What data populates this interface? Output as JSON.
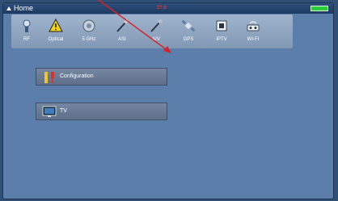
{
  "header": {
    "title": "Home",
    "center_text": "27.8",
    "icons": {
      "home": "home-icon",
      "battery": "battery-icon"
    }
  },
  "modules": [
    {
      "id": "rf",
      "label": "RF",
      "icon": "antenna-icon"
    },
    {
      "id": "optical",
      "label": "Optical",
      "icon": "warning-triangle-icon"
    },
    {
      "id": "5ghz",
      "label": "5 GHz",
      "icon": "satellite-dish-icon"
    },
    {
      "id": "asi",
      "label": "ASI",
      "icon": "cable-connector-icon"
    },
    {
      "id": "av",
      "label": "A/V",
      "icon": "av-cable-icon"
    },
    {
      "id": "gps",
      "label": "GPS",
      "icon": "satellite-icon"
    },
    {
      "id": "iptv",
      "label": "IPTV",
      "icon": "ethernet-port-icon"
    },
    {
      "id": "wifi",
      "label": "WI-FI",
      "icon": "wifi-router-icon"
    }
  ],
  "menu": [
    {
      "id": "configuration",
      "label": "Configuration",
      "icon": "tools-icon"
    },
    {
      "id": "tv",
      "label": "TV",
      "icon": "tv-icon"
    }
  ],
  "colors": {
    "screen_bg": "#5b7faa",
    "titlebar": "#1d3a60",
    "module_bar": "#9fb4cc",
    "button": "#6b7d96",
    "battery": "#2ccb3a",
    "pointer_arrow": "#d8202a"
  }
}
